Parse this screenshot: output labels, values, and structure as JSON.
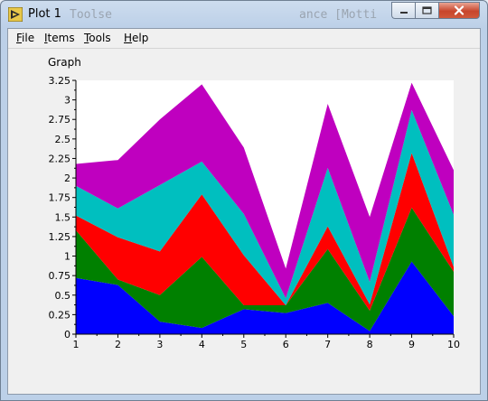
{
  "window": {
    "title": "Plot 1",
    "background_text_left": "Toolse",
    "background_text_right": "ance [Motti"
  },
  "menu": [
    {
      "mnemonic": "F",
      "rest": "ile"
    },
    {
      "mnemonic": "I",
      "rest": "tems"
    },
    {
      "mnemonic": "T",
      "rest": "ools"
    },
    {
      "mnemonic": "H",
      "rest": "elp"
    }
  ],
  "graph": {
    "label": "Graph"
  },
  "colors": {
    "series": [
      "#0000ff",
      "#008000",
      "#ff0000",
      "#00bfbf",
      "#bf00bf"
    ],
    "plot_background": "#ffffff",
    "close_button": "#c8452b"
  },
  "chart_data": {
    "type": "area",
    "stacked": true,
    "x": [
      1,
      2,
      3,
      4,
      5,
      6,
      7,
      8,
      9,
      10
    ],
    "series": [
      {
        "values": [
          0.72,
          0.63,
          0.16,
          0.08,
          0.32,
          0.27,
          0.4,
          0.04,
          0.93,
          0.23
        ]
      },
      {
        "values": [
          0.61,
          0.07,
          0.34,
          0.91,
          0.05,
          0.1,
          0.69,
          0.26,
          0.69,
          0.57
        ]
      },
      {
        "values": [
          0.19,
          0.54,
          0.56,
          0.8,
          0.64,
          0.0,
          0.29,
          0.08,
          0.7,
          0.06
        ]
      },
      {
        "values": [
          0.38,
          0.37,
          0.85,
          0.42,
          0.53,
          0.09,
          0.75,
          0.29,
          0.55,
          0.67
        ]
      },
      {
        "values": [
          0.28,
          0.62,
          0.84,
          0.99,
          0.85,
          0.38,
          0.82,
          0.83,
          0.35,
          0.57
        ]
      }
    ],
    "xlim": [
      1,
      10
    ],
    "ylim": [
      0,
      3.25
    ],
    "xticks": [
      "1",
      "2",
      "3",
      "4",
      "5",
      "6",
      "7",
      "8",
      "9",
      "10"
    ],
    "yticks": [
      "0",
      "0.25",
      "0.5",
      "0.75",
      "1",
      "1.25",
      "1.5",
      "1.75",
      "2",
      "2.25",
      "2.5",
      "2.75",
      "3",
      "3.25"
    ],
    "grid": false,
    "legend": "none"
  }
}
